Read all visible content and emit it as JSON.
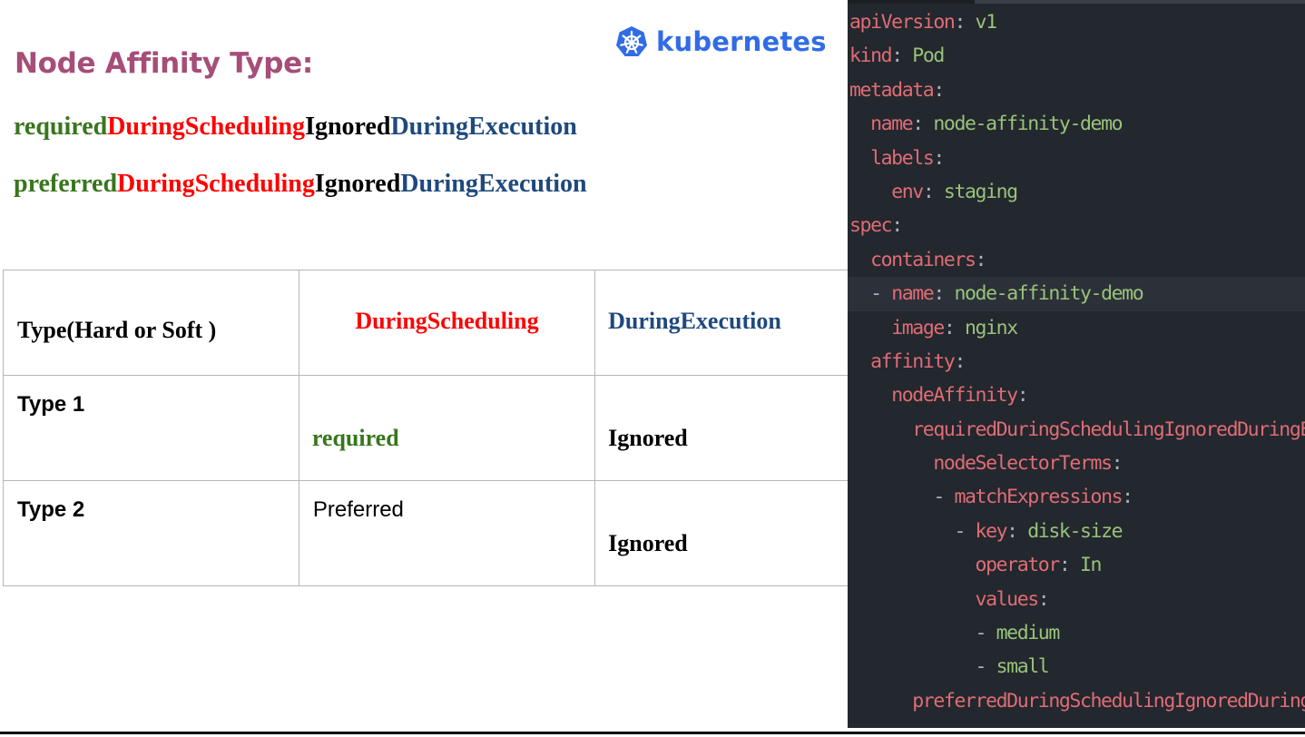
{
  "slide": {
    "title": "Node Affinity Type:",
    "logo_text": "kubernetes",
    "terms": [
      [
        {
          "text": "required",
          "color": "green"
        },
        {
          "text": "DuringScheduling",
          "color": "red"
        },
        {
          "text": "Ignored",
          "color": "black"
        },
        {
          "text": "DuringExecution",
          "color": "blue"
        }
      ],
      [
        {
          "text": "preferred",
          "color": "green"
        },
        {
          "text": "DuringScheduling",
          "color": "red"
        },
        {
          "text": "Ignored",
          "color": "black"
        },
        {
          "text": "DuringExecution",
          "color": "blue"
        }
      ]
    ],
    "table": {
      "headers": [
        "Type(Hard or Soft )",
        "DuringScheduling",
        "DuringExecution"
      ],
      "rows": [
        [
          "Type 1",
          "required",
          "Ignored"
        ],
        [
          "Type 2",
          "Preferred",
          "Ignored"
        ]
      ]
    }
  },
  "code": {
    "lines": [
      {
        "indent": "",
        "key": "apiVersion",
        "value": "v1"
      },
      {
        "indent": "",
        "key": "kind",
        "value": "Pod"
      },
      {
        "indent": "",
        "key": "metadata",
        "value": ""
      },
      {
        "indent": "  ",
        "key": "name",
        "value": "node-affinity-demo"
      },
      {
        "indent": "  ",
        "key": "labels",
        "value": ""
      },
      {
        "indent": "    ",
        "key": "env",
        "value": "staging"
      },
      {
        "indent": "",
        "key": "spec",
        "value": ""
      },
      {
        "indent": "  ",
        "key": "containers",
        "value": ""
      },
      {
        "indent": "  - ",
        "key": "name",
        "value": "node-affinity-demo",
        "highlight": true
      },
      {
        "indent": "    ",
        "key": "image",
        "value": "nginx"
      },
      {
        "indent": "  ",
        "key": "affinity",
        "value": ""
      },
      {
        "indent": "    ",
        "key": "nodeAffinity",
        "value": ""
      },
      {
        "indent": "      ",
        "key": "requiredDuringSchedulingIgnoredDuringExec",
        "value": "",
        "nocolon": true
      },
      {
        "indent": "        ",
        "key": "nodeSelectorTerms",
        "value": ""
      },
      {
        "indent": "        - ",
        "key": "matchExpressions",
        "value": ""
      },
      {
        "indent": "          - ",
        "key": "key",
        "value": "disk-size"
      },
      {
        "indent": "            ",
        "key": "operator",
        "value": "In"
      },
      {
        "indent": "            ",
        "key": "values",
        "value": ""
      },
      {
        "indent": "            - ",
        "key": "",
        "value": "medium"
      },
      {
        "indent": "            - ",
        "key": "",
        "value": "small"
      },
      {
        "indent": "      ",
        "key": "preferredDuringSchedulingIgnoredDuringExe",
        "value": "",
        "nocolon": true
      }
    ]
  }
}
